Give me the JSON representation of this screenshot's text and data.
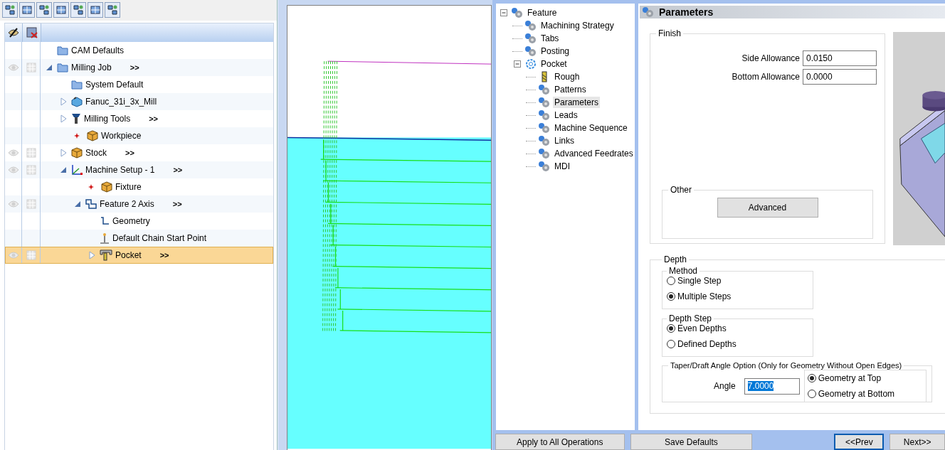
{
  "operations_tree": {
    "nodes": [
      {
        "label": "CAM Defaults",
        "kind": "folder",
        "eye": false
      },
      {
        "label": "Milling Job",
        "kind": "folder",
        "eye": true,
        "more": ">>",
        "expanded": true,
        "selected": false,
        "children": [
          {
            "label": "System Default",
            "kind": "folder",
            "eye": false
          },
          {
            "label": "Fanuc_31i_3x_Mill",
            "kind": "machine",
            "eye": false,
            "expanded": false
          },
          {
            "label": "Milling Tools",
            "kind": "tool",
            "eye": false,
            "expanded": false,
            "more": ">>"
          },
          {
            "label": "Workpiece",
            "kind": "box",
            "eye": false,
            "marked": true
          },
          {
            "label": "Stock",
            "kind": "box",
            "eye": true,
            "expanded": false,
            "more": ">>"
          },
          {
            "label": "Machine Setup - 1",
            "kind": "axes",
            "eye": true,
            "expanded": true,
            "more": ">>",
            "children": [
              {
                "label": "Fixture",
                "kind": "box",
                "eye": false,
                "marked": true
              },
              {
                "label": "Feature 2 Axis",
                "kind": "feature",
                "eye": true,
                "expanded": true,
                "more": ">>",
                "children": [
                  {
                    "label": "Geometry",
                    "kind": "geometry",
                    "eye": false
                  },
                  {
                    "label": "Default Chain Start Point",
                    "kind": "startpoint",
                    "eye": false
                  },
                  {
                    "label": "Pocket",
                    "kind": "pocket",
                    "eye": true,
                    "expanded": false,
                    "more": ">>",
                    "selected": true
                  }
                ]
              }
            ]
          }
        ]
      }
    ]
  },
  "feature_tree": {
    "items": [
      {
        "label": "Feature",
        "kind": "gear",
        "expanded": true,
        "selected": false,
        "children": [
          {
            "label": "Machining Strategy",
            "kind": "gear",
            "selected": false
          },
          {
            "label": "Tabs",
            "kind": "gear",
            "selected": false
          },
          {
            "label": "Posting",
            "kind": "gear",
            "selected": false
          },
          {
            "label": "Pocket",
            "kind": "outline",
            "expanded": true,
            "selected": false,
            "children": [
              {
                "label": "Rough",
                "kind": "tool",
                "selected": false
              },
              {
                "label": "Patterns",
                "kind": "gear",
                "selected": false
              },
              {
                "label": "Parameters",
                "kind": "gear",
                "selected": true
              },
              {
                "label": "Leads",
                "kind": "gear",
                "selected": false
              },
              {
                "label": "Machine Sequence",
                "kind": "gear",
                "selected": false
              },
              {
                "label": "Links",
                "kind": "gear",
                "selected": false
              },
              {
                "label": "Advanced Feedrates",
                "kind": "gear",
                "selected": false
              },
              {
                "label": "MDI",
                "kind": "gear",
                "selected": false
              }
            ]
          }
        ]
      }
    ]
  },
  "parameters": {
    "title": "Parameters",
    "finish": {
      "title": "Finish",
      "fields": [
        {
          "label": "Side Allowance",
          "value": "0.0150"
        },
        {
          "label": "Bottom Allowance",
          "value": "0.0000"
        }
      ],
      "other": {
        "title": "Other",
        "button": "Advanced"
      }
    },
    "depth": {
      "title": "Depth",
      "method": {
        "title": "Method",
        "options": [
          {
            "label": "Single Step",
            "selected": false
          },
          {
            "label": "Multiple Steps",
            "selected": true
          }
        ]
      },
      "depth_step": {
        "title": "Depth Step",
        "options": [
          {
            "label": "Even Depths",
            "selected": true
          },
          {
            "label": "Defined Depths",
            "selected": false
          }
        ]
      },
      "taper": {
        "title": "Taper/Draft Angle Option (Only for Geometry Without Open Edges)",
        "angle_label": "Angle",
        "angle_value": "7.0000",
        "angle_text_selected": true,
        "options": [
          {
            "label": "Geometry at Top",
            "selected": true
          },
          {
            "label": "Geometry at Bottom",
            "selected": false
          }
        ]
      }
    }
  },
  "buttons": [
    {
      "label": "Apply to All Operations",
      "focused": false
    },
    {
      "label": "Save Defaults",
      "focused": false
    },
    {
      "label": "<<Prev",
      "focused": true
    },
    {
      "label": "Next>>",
      "focused": false
    }
  ]
}
